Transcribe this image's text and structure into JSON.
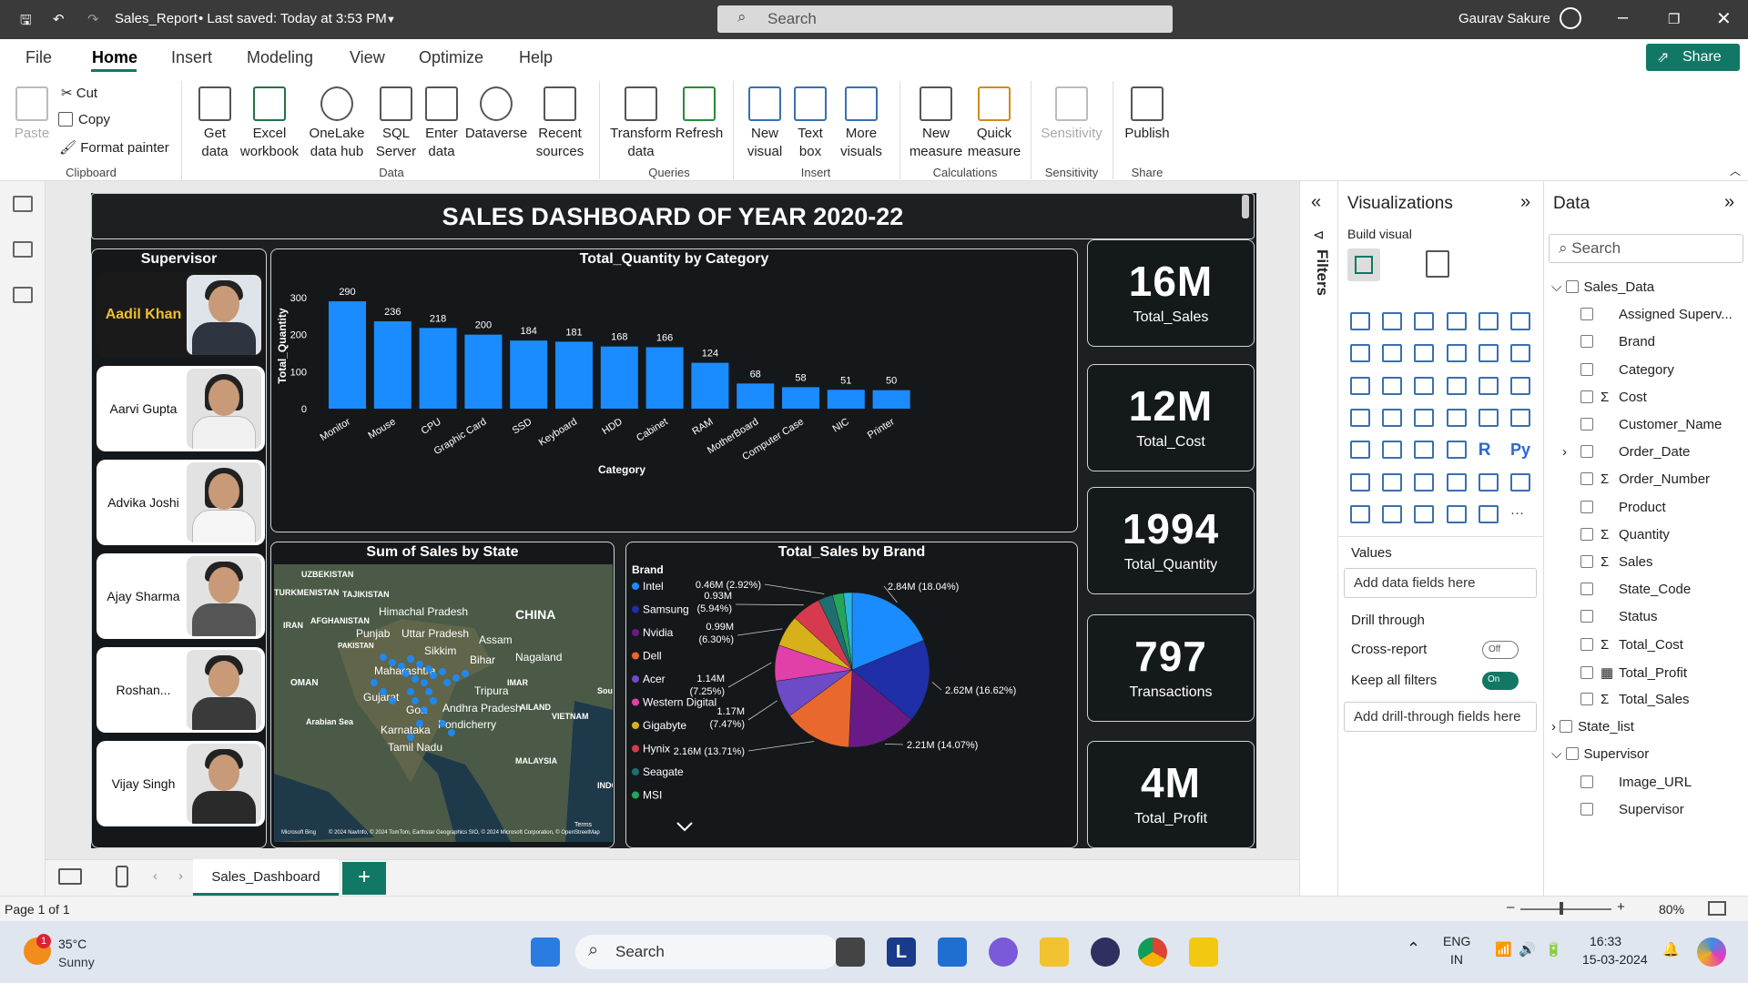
{
  "titlebar": {
    "file": "Sales_Report",
    "saved": "• Last saved: Today at 3:53 PM",
    "search": "Search",
    "user": "Gaurav Sakure"
  },
  "tabs": [
    "File",
    "Home",
    "Insert",
    "Modeling",
    "View",
    "Optimize",
    "Help"
  ],
  "share": "Share",
  "ribbon": {
    "clipboard": {
      "paste": "Paste",
      "cut": "Cut",
      "copy": "Copy",
      "format_painter": "Format painter",
      "group": "Clipboard"
    },
    "data": {
      "get_data": "Get data",
      "excel": "Excel workbook",
      "onelake": "OneLake data hub",
      "sql": "SQL Server",
      "enter": "Enter data",
      "dataverse": "Dataverse",
      "recent": "Recent sources",
      "group": "Data"
    },
    "queries": {
      "transform": "Transform data",
      "refresh": "Refresh",
      "group": "Queries"
    },
    "insert": {
      "new_visual": "New visual",
      "text_box": "Text box",
      "more_visuals": "More visuals",
      "group": "Insert"
    },
    "calculations": {
      "new_measure": "New measure",
      "quick_measure": "Quick measure",
      "group": "Calculations"
    },
    "sensitivity": {
      "label": "Sensitivity",
      "group": "Sensitivity"
    },
    "share": {
      "publish": "Publish",
      "group": "Share"
    }
  },
  "report": {
    "title": "SALES DASHBOARD OF YEAR 2020-22",
    "supervisor_title": "Supervisor",
    "supervisors": [
      "Aadil Khan",
      "Aarvi Gupta",
      "Advika Joshi",
      "Ajay Sharma",
      "Roshan...",
      "Vijay Singh"
    ],
    "map": {
      "title": "Sum of Sales by State",
      "labels": [
        "UZBEKISTAN",
        "TURKMENISTAN",
        "TAJIKISTAN",
        "Himachal Pradesh",
        "CHINA",
        "IRAN",
        "AFGHANISTAN",
        "Punjab",
        "Uttar Pradesh",
        "Assam",
        "PAKISTAN",
        "Sikkim",
        "Bihar",
        "Nagaland",
        "Maharashtra",
        "OMAN",
        "IMAR",
        "Tripura",
        "Gujarat",
        "Goa",
        "Andhra Pradesh",
        "AILAND",
        "South China Sea",
        "VIETNAM",
        "Arabian Sea",
        "Karnataka",
        "Pondicherry",
        "Tamil Nadu",
        "MALAYSIA",
        "INDO"
      ],
      "attribution": "© 2024 NavInfo, © 2024 TomTom, Earthstar Geographics SIO, © 2024 Microsoft Corporation, © OpenStreetMap",
      "terms": "Terms",
      "bing": "Microsoft Bing"
    },
    "kpis": [
      {
        "value": "16M",
        "label": "Total_Sales"
      },
      {
        "value": "12M",
        "label": "Total_Cost"
      },
      {
        "value": "1994",
        "label": "Total_Quantity"
      },
      {
        "value": "797",
        "label": "Transactions"
      },
      {
        "value": "4M",
        "label": "Total_Profit"
      }
    ]
  },
  "chart_data": [
    {
      "type": "bar",
      "title": "Total_Quantity by Category",
      "xlabel": "Category",
      "ylabel": "Total_Quantity",
      "ylim": [
        0,
        300
      ],
      "yticks": [
        0,
        100,
        200,
        300
      ],
      "categories": [
        "Monitor",
        "Mouse",
        "CPU",
        "Graphic Card",
        "SSD",
        "Keyboard",
        "HDD",
        "Cabinet",
        "RAM",
        "MotherBoard",
        "Computer Case",
        "NIC",
        "Printer"
      ],
      "values": [
        290,
        236,
        218,
        200,
        184,
        181,
        168,
        166,
        124,
        68,
        58,
        51,
        50
      ],
      "color": "#1a8cff"
    },
    {
      "type": "pie",
      "title": "Total_Sales by Brand",
      "legend_title": "Brand",
      "legend": "left",
      "slices": [
        {
          "name": "Intel",
          "value": 2.84,
          "label": "2.84M (18.04%)",
          "color": "#1a8cff"
        },
        {
          "name": "Samsung",
          "value": 2.62,
          "label": "2.62M (16.62%)",
          "color": "#1f2fa8"
        },
        {
          "name": "Nvidia",
          "value": 2.21,
          "label": "2.21M (14.07%)",
          "color": "#6a1a86"
        },
        {
          "name": "Dell",
          "value": 2.16,
          "label": "2.16M (13.71%)",
          "color": "#e8682e"
        },
        {
          "name": "Acer",
          "value": 1.17,
          "label": "1.17M (7.47%)",
          "color": "#6d4bc7"
        },
        {
          "name": "Western Digital",
          "value": 1.14,
          "label": "1.14M (7.25%)",
          "color": "#e040a8"
        },
        {
          "name": "Gigabyte",
          "value": 0.99,
          "label": "0.99M (6.30%)",
          "color": "#d8b01a"
        },
        {
          "name": "Hynix",
          "value": 0.93,
          "label": "0.93M (5.94%)",
          "color": "#d63a4e"
        },
        {
          "name": "Seagate",
          "value": 0.46,
          "label": "0.46M (2.92%)",
          "color": "#1f6f72"
        },
        {
          "name": "MSI",
          "value": 0.35,
          "label": "",
          "color": "#23a659"
        },
        {
          "name": "",
          "value": 0.27,
          "label": "",
          "color": "#2bb5e0"
        }
      ]
    }
  ],
  "filters_label": "Filters",
  "viz": {
    "title": "Visualizations",
    "build": "Build visual",
    "values": "Values",
    "add_data": "Add data fields here",
    "drill": "Drill through",
    "cross": "Cross-report",
    "cross_state": "Off",
    "keep": "Keep all filters",
    "keep_state": "On",
    "add_drill": "Add drill-through fields here",
    "r": "R",
    "py": "Py",
    "more": "···"
  },
  "data_pane": {
    "title": "Data",
    "search": "Search",
    "tables": [
      {
        "name": "Sales_Data",
        "fields": [
          "Assigned Superv...",
          "Brand",
          "Category",
          "Cost",
          "Customer_Name",
          "Order_Date",
          "Order_Number",
          "Product",
          "Quantity",
          "Sales",
          "State_Code",
          "Status",
          "Total_Cost",
          "Total_Profit",
          "Total_Sales"
        ],
        "sigma": [
          false,
          false,
          false,
          true,
          false,
          false,
          true,
          false,
          true,
          true,
          false,
          false,
          true,
          false,
          true
        ]
      },
      {
        "name": "State_list",
        "fields": []
      },
      {
        "name": "Supervisor",
        "fields": [
          "Image_URL",
          "Supervisor"
        ]
      }
    ]
  },
  "page_tab": "Sales_Dashboard",
  "status": {
    "page": "Page 1 of 1",
    "zoom": "80%"
  },
  "taskbar": {
    "temp": "35°C",
    "weather": "Sunny",
    "search": "Search",
    "lang1": "ENG",
    "lang2": "IN",
    "time": "16:33",
    "date": "15-03-2024",
    "notif": "1"
  }
}
